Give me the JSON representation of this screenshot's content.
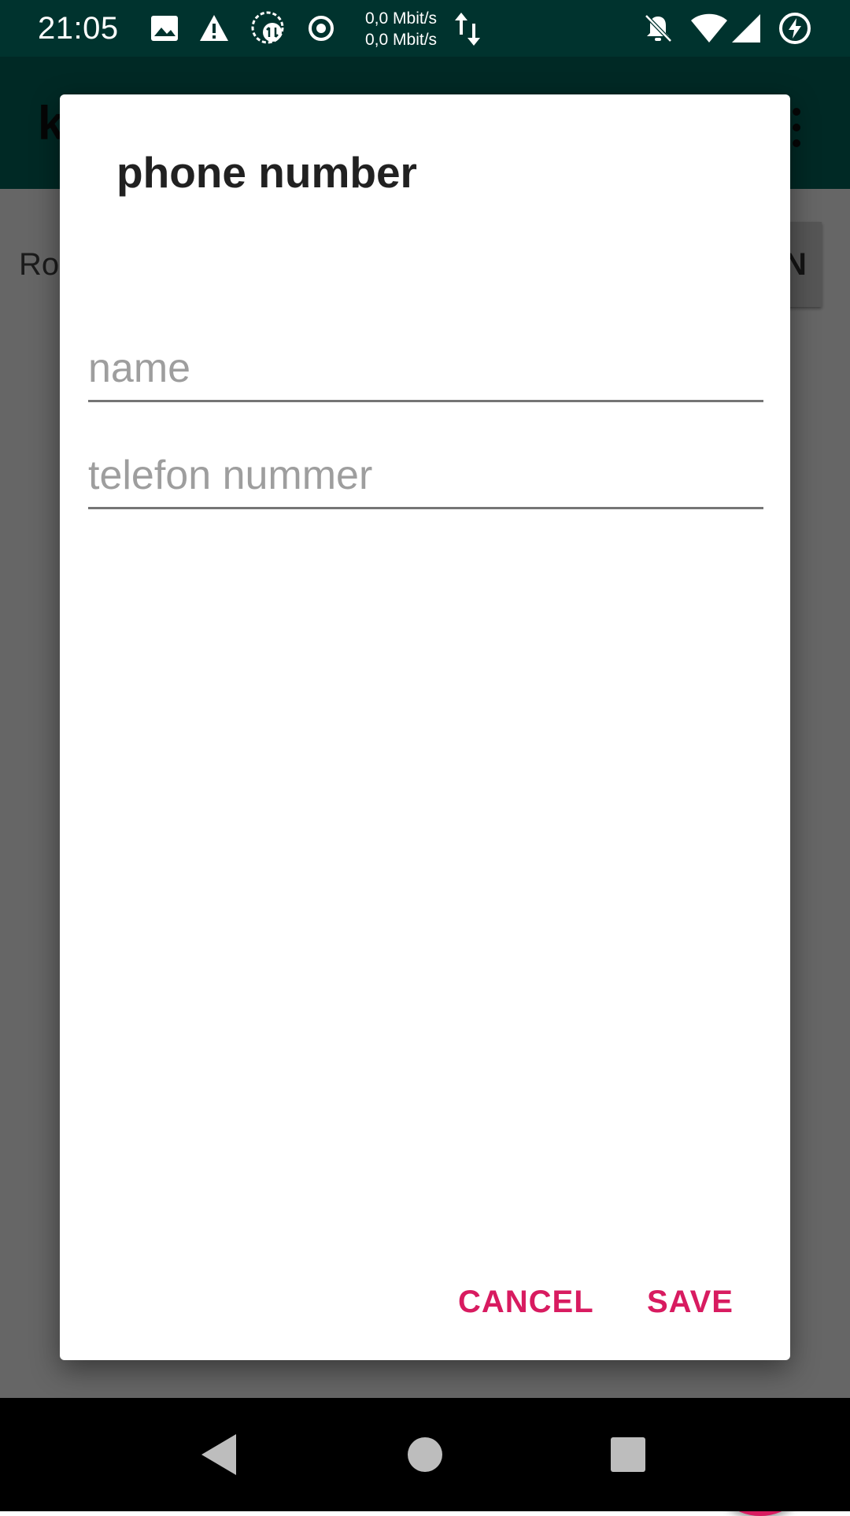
{
  "status_bar": {
    "time": "21:05",
    "net_up": "0,0 Mbit/s",
    "net_down": "0,0 Mbit/s",
    "icons": [
      "image-icon",
      "warning-icon",
      "sync-icon",
      "record-icon",
      "data-arrows-icon",
      "bell-off-icon",
      "wifi-icon",
      "signal-icon",
      "battery-charging-icon"
    ]
  },
  "background_app": {
    "title_fragment": "k",
    "row_label_fragment": "Ro",
    "button_fragment": "N",
    "app_bar_color": "#00685d",
    "fab_color": "#d81b60"
  },
  "dialog": {
    "title": "phone number",
    "name_field": {
      "value": "",
      "placeholder": "name"
    },
    "phone_field": {
      "value": "",
      "placeholder": "telefon nummer"
    },
    "cancel_label": "CANCEL",
    "save_label": "SAVE",
    "accent_color": "#d81b60"
  },
  "nav_bar": {
    "icons": [
      "back-icon",
      "home-icon",
      "recents-icon"
    ]
  }
}
